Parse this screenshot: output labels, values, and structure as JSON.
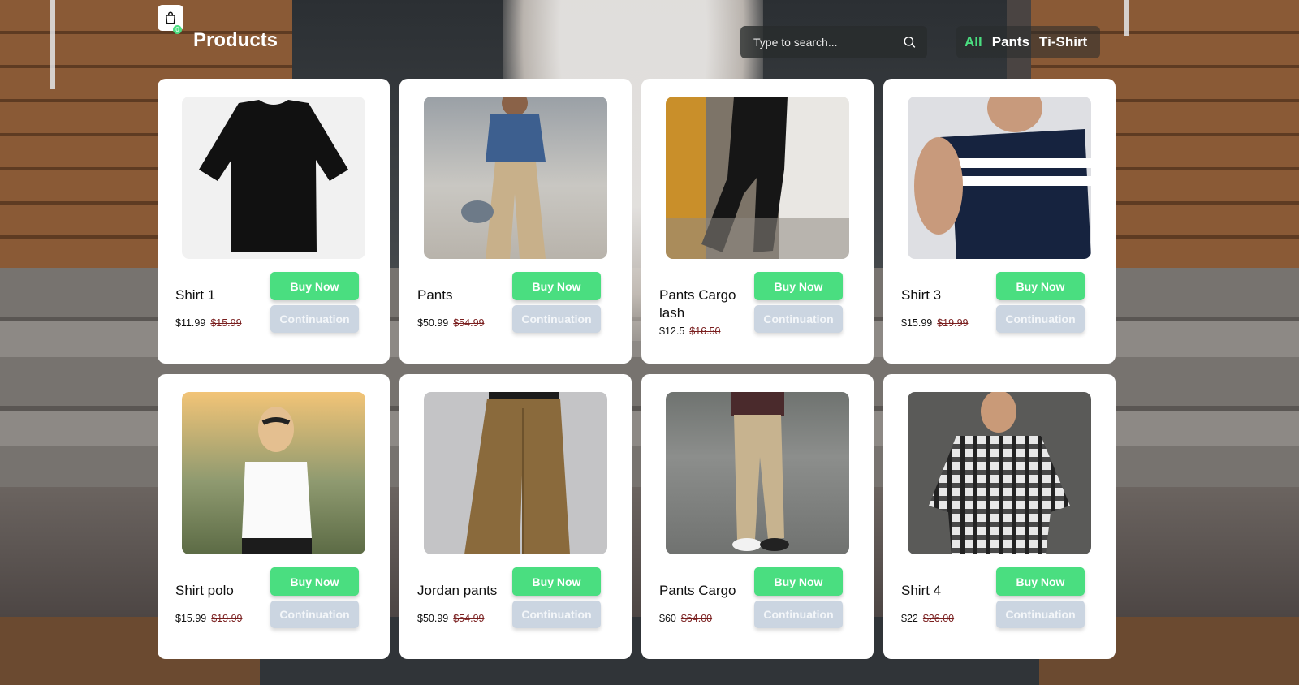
{
  "header": {
    "title": "Products",
    "cart_count": "0",
    "search": {
      "placeholder": "Type to search..."
    },
    "filters": [
      {
        "label": "All",
        "active": true
      },
      {
        "label": "Pants",
        "active": false
      },
      {
        "label": "Ti-Shirt",
        "active": false
      }
    ]
  },
  "buttons": {
    "buy": "Buy Now",
    "continuation": "Continuation"
  },
  "products": [
    {
      "name": "Shirt 1",
      "price": "$11.99",
      "old_price": "$15.99"
    },
    {
      "name": "Pants",
      "price": "$50.99",
      "old_price": "$54.99"
    },
    {
      "name": "Pants Cargo lash",
      "price": "$12.5",
      "old_price": "$16.50"
    },
    {
      "name": "Shirt 3",
      "price": "$15.99",
      "old_price": "$19.99"
    },
    {
      "name": "Shirt polo",
      "price": "$15.99",
      "old_price": "$19.99"
    },
    {
      "name": "Jordan pants",
      "price": "$50.99",
      "old_price": "$54.99"
    },
    {
      "name": "Pants Cargo",
      "price": "$60",
      "old_price": "$64.00"
    },
    {
      "name": "Shirt 4",
      "price": "$22",
      "old_price": "$26.00"
    }
  ],
  "colors": {
    "accent": "#4ade80",
    "secondary_button": "#cbd5e1",
    "old_price": "#7a1f1f"
  }
}
